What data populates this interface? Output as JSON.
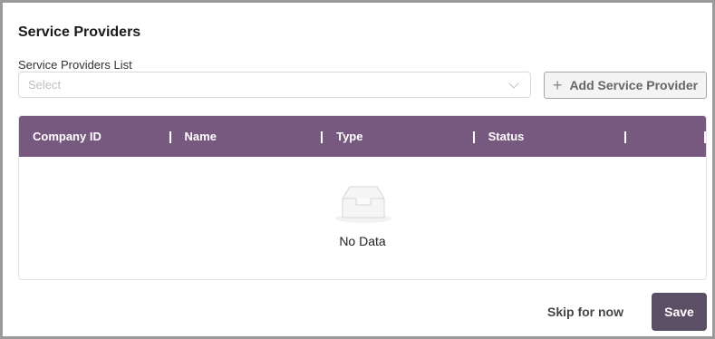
{
  "page": {
    "title": "Service Providers"
  },
  "service_providers": {
    "list_label": "Service Providers List",
    "select_placeholder": "Select",
    "add_button_label": "Add Service Provider"
  },
  "table": {
    "columns": [
      "Company ID",
      "Name",
      "Type",
      "Status"
    ],
    "rows": [],
    "empty_text": "No Data"
  },
  "footer": {
    "skip_label": "Skip for now",
    "save_label": "Save"
  },
  "colors": {
    "header_bg": "#77587f",
    "save_bg": "#5b4f65"
  },
  "icons": {
    "select": "chevron-down-icon",
    "add": "plus-icon",
    "empty": "empty-inbox-icon"
  }
}
